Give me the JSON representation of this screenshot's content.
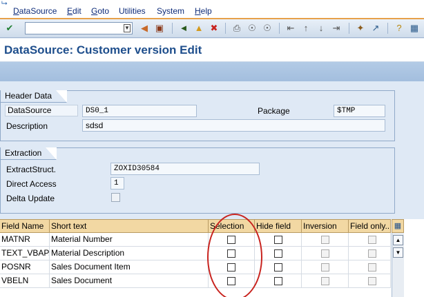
{
  "menu": [
    "DataSource",
    "Edit",
    "Goto",
    "Utilities",
    "System",
    "Help"
  ],
  "menu_underline": [
    "D",
    "E",
    "G",
    "",
    "",
    "H"
  ],
  "toolbar": {
    "command_value": "",
    "icons": [
      "enter-icon",
      "back-arrow-icon",
      "save-icon",
      "back-icon",
      "exit-icon",
      "cancel-icon",
      "print-icon",
      "find-icon",
      "find-next-icon",
      "first-page-icon",
      "previous-page-icon",
      "next-page-icon",
      "last-page-icon",
      "create-session-icon",
      "shortcut-icon",
      "help-icon",
      "layout-icon"
    ]
  },
  "title": "DataSource: Customer version Edit",
  "header_group": {
    "label": "Header Data",
    "datasource_label": "DataSource",
    "datasource_value": "DS0_1",
    "package_label": "Package",
    "package_value": "$TMP",
    "description_label": "Description",
    "description_value": "sdsd"
  },
  "extraction_group": {
    "label": "Extraction",
    "extract_label": "ExtractStruct.",
    "extract_value": "ZOXID30584",
    "direct_label": "Direct Access",
    "direct_value": "1",
    "delta_label": "Delta Update"
  },
  "table": {
    "columns": [
      "Field Name",
      "Short text",
      "Selection",
      "Hide field",
      "Inversion",
      "Field only..."
    ],
    "rows": [
      {
        "field": "MATNR",
        "text": "Material Number"
      },
      {
        "field": "TEXT_VBAP...",
        "text": "Material Description"
      },
      {
        "field": "POSNR",
        "text": "Sales Document Item"
      },
      {
        "field": "VBELN",
        "text": "Sales Document"
      }
    ]
  },
  "colors": {
    "accent": "#1e4e8c",
    "header_bg": "#f2d8a3",
    "highlight": "#c8231e"
  }
}
